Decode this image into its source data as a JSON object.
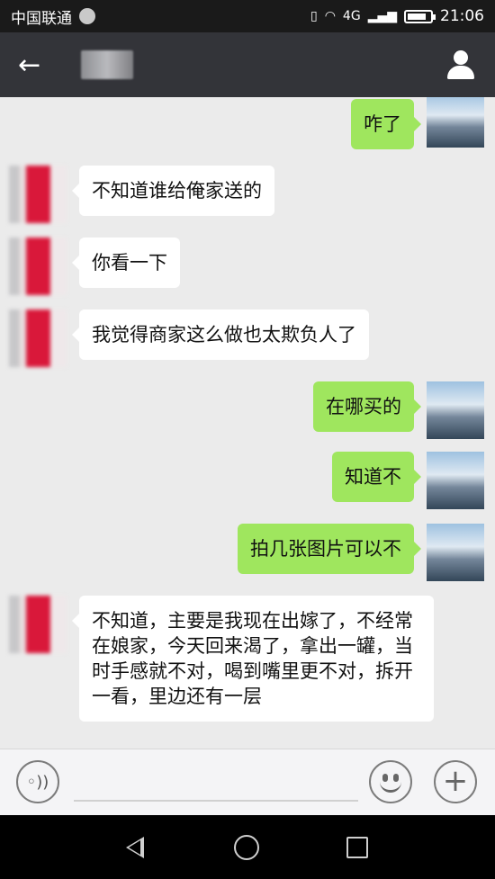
{
  "status_bar": {
    "carrier": "中国联通",
    "network": "4G",
    "time": "21:06"
  },
  "nav": {
    "contact_name": "",
    "back_icon": "arrow-left",
    "profile_icon": "person"
  },
  "messages": [
    {
      "side": "right",
      "text": "咋了"
    },
    {
      "side": "left",
      "text": "不知道谁给俺家送的"
    },
    {
      "side": "left",
      "text": "你看一下"
    },
    {
      "side": "left",
      "text": "我觉得商家这么做也太欺负人了"
    },
    {
      "side": "right",
      "text": "在哪买的"
    },
    {
      "side": "right",
      "text": "知道不"
    },
    {
      "side": "right",
      "text": "拍几张图片可以不"
    },
    {
      "side": "left",
      "text": "不知道，主要是我现在出嫁了，不经常在娘家，今天回来渴了，拿出一罐，当时手感就不对，喝到嘴里更不对，拆开一看，里边还有一层"
    }
  ],
  "input_bar": {
    "placeholder": "",
    "voice_icon": "voice",
    "emoji_icon": "smiley",
    "plus_icon": "plus"
  },
  "colors": {
    "self_bubble": "#9fe65e",
    "other_bubble": "#ffffff",
    "chat_bg": "#ebebeb",
    "nav_bg": "#333439"
  }
}
